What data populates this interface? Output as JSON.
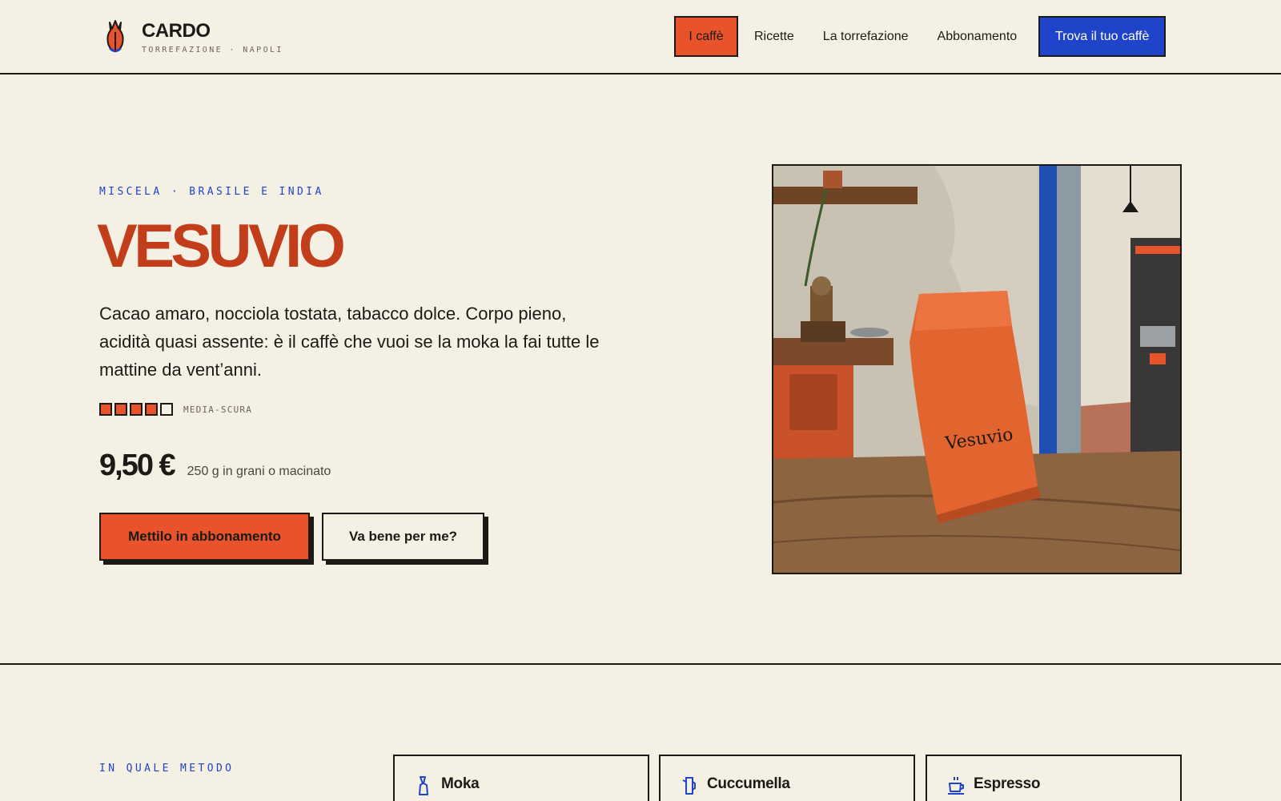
{
  "brand": {
    "name": "CARDO",
    "subtitle": "TORREFAZIONE · NAPOLI"
  },
  "nav": {
    "items": [
      {
        "label": "I caffè",
        "active": true
      },
      {
        "label": "Ricette",
        "active": false
      },
      {
        "label": "La torrefazione",
        "active": false
      },
      {
        "label": "Abbonamento",
        "active": false
      }
    ],
    "cta": "Trova il tuo caffè"
  },
  "hero": {
    "eyebrow": "MISCELA · BRASILE E INDIA",
    "title": "VESUVIO",
    "description": "Cacao amaro, nocciola tostata, tabacco dolce. Corpo pieno, acidità quasi assente: è il caffè che vuoi se la moka la fai tutte le mattine da vent’anni.",
    "roast": {
      "level": 4,
      "max": 5,
      "label": "MEDIA-SCURA"
    },
    "price": "9,50 €",
    "price_note": "250 g in grani o macinato",
    "primary_button": "Mettilo in abbonamento",
    "secondary_button": "Va bene per me?",
    "image": {
      "bag_label": "Vesuvio"
    }
  },
  "methods": {
    "eyebrow": "IN QUALE METODO",
    "items": [
      {
        "label": "Moka",
        "icon": "moka-icon"
      },
      {
        "label": "Cuccumella",
        "icon": "cuccumella-icon"
      },
      {
        "label": "Espresso",
        "icon": "espresso-icon"
      }
    ]
  },
  "colors": {
    "background": "#f5f0e4",
    "accent_orange": "#e8532b",
    "title_red": "#c23e1b",
    "accent_blue": "#1f43c9",
    "ink": "#1c1a16"
  }
}
